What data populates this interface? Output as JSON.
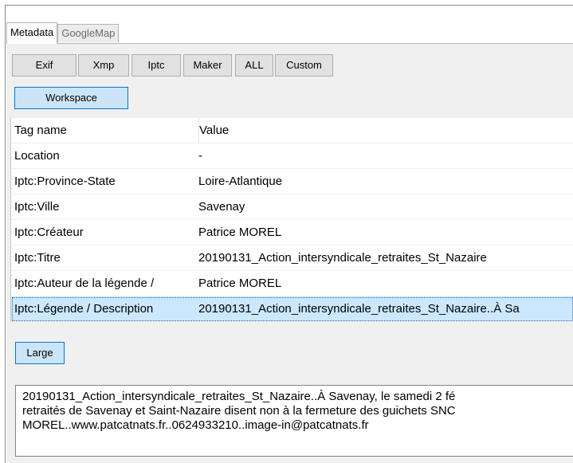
{
  "tabs": [
    {
      "label": "Metadata",
      "active": true
    },
    {
      "label": "GoogleMap",
      "active": false
    }
  ],
  "toolbar": {
    "buttons": [
      "Exif",
      "Xmp",
      "Iptc",
      "Maker",
      "ALL",
      "Custom"
    ],
    "workspace_label": "Workspace"
  },
  "table": {
    "headers": [
      "Tag name",
      "Value"
    ],
    "rows": [
      {
        "tag": "Location",
        "value": "-"
      },
      {
        "tag": "Iptc:Province-State",
        "value": "Loire-Atlantique"
      },
      {
        "tag": "Iptc:Ville",
        "value": "Savenay"
      },
      {
        "tag": "Iptc:Créateur",
        "value": "Patrice MOREL"
      },
      {
        "tag": "Iptc:Titre",
        "value": "20190131_Action_intersyndicale_retraites_St_Nazaire"
      },
      {
        "tag": "Iptc:Auteur de la légende /",
        "value": "Patrice MOREL"
      },
      {
        "tag": "Iptc:Légende / Description",
        "value": "20190131_Action_intersyndicale_retraites_St_Nazaire..À Sa",
        "selected": true
      }
    ]
  },
  "large_button_label": "Large",
  "description": {
    "line1": "20190131_Action_intersyndicale_retraites_St_Nazaire..À Savenay, le samedi 2 fé",
    "line2": "retraités de Savenay et Saint-Nazaire disent non à la fermeture des guichets SNC",
    "line3": "MOREL..www.patcatnats.fr..0624933210..image-in@patcatnats.fr"
  },
  "colors": {
    "selection": "#cce8ff",
    "focus_border": "#0078d7",
    "button_face": "#e1e1e1"
  }
}
